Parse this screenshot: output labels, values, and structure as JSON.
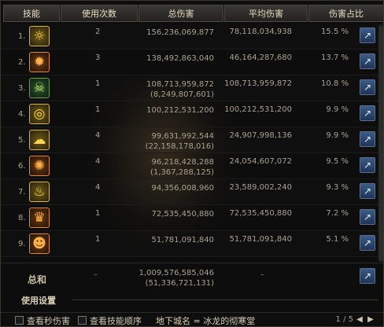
{
  "headers": {
    "skill": "技能",
    "uses": "使用次数",
    "total": "总伤害",
    "average": "平均伤害",
    "share": "伤害占比"
  },
  "rows": [
    {
      "rank": "1.",
      "icon": "tribal-mask-icon",
      "uses": "2",
      "total": "156,236,069,877",
      "total_sub": "",
      "average": "78,118,034,938",
      "share": "15.5 %"
    },
    {
      "rank": "2.",
      "icon": "pumpkin-blast-icon",
      "uses": "3",
      "total": "138,492,863,040",
      "total_sub": "",
      "average": "46,164,287,680",
      "share": "13.7 %"
    },
    {
      "rank": "3.",
      "icon": "green-skull-icon",
      "uses": "1",
      "total": "108,713,959,872",
      "total_sub": "(8,249,807,601)",
      "average": "108,713,959,872",
      "share": "10.8 %"
    },
    {
      "rank": "4.",
      "icon": "spiral-eye-icon",
      "uses": "1",
      "total": "100,212,531,200",
      "total_sub": "",
      "average": "100,212,531,200",
      "share": "9.9 %"
    },
    {
      "rank": "5.",
      "icon": "storm-cloud-icon",
      "uses": "4",
      "total": "99,631,992,544",
      "total_sub": "(22,158,178,016)",
      "average": "24,907,998,136",
      "share": "9.9 %"
    },
    {
      "rank": "6.",
      "icon": "pumpkin-bomb-icon",
      "uses": "4",
      "total": "96,218,428,288",
      "total_sub": "(1,367,288,125)",
      "average": "24,054,607,072",
      "share": "9.5 %"
    },
    {
      "rank": "7.",
      "icon": "fire-arch-icon",
      "uses": "4",
      "total": "94,356,008,960",
      "total_sub": "",
      "average": "23,589,002,240",
      "share": "9.3 %"
    },
    {
      "rank": "8.",
      "icon": "crowned-pumpkin-icon",
      "uses": "1",
      "total": "72,535,450,880",
      "total_sub": "",
      "average": "72,535,450,880",
      "share": "7.2 %"
    },
    {
      "rank": "9.",
      "icon": "jack-o-lantern-icon",
      "uses": "1",
      "total": "51,781,091,840",
      "total_sub": "",
      "average": "51,781,091,840",
      "share": "5.1 %"
    }
  ],
  "summary": {
    "label": "总和",
    "uses": "–",
    "total": "1,009,576,585,046",
    "total_sub": "(51,336,721,131)",
    "average": "–"
  },
  "settings_title": "使用设置",
  "bottom": {
    "check_dps": "查看秒伤害",
    "check_order": "查看技能顺序",
    "dungeon": "地下城名 = 冰龙的彻寒堂",
    "page": "1 / 5"
  }
}
